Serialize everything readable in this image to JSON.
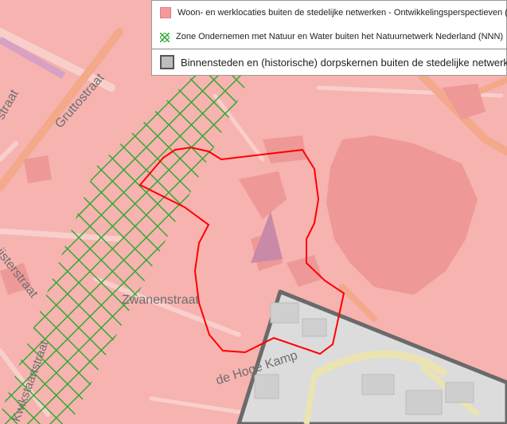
{
  "legend": {
    "items": [
      {
        "label": "Woon- en werklocaties buiten de stedelijke netwerken - Ontwikkelingsperspectieven (",
        "swatch": "#f49a9a"
      },
      {
        "label": "Zone Ondernemen met Natuur en Water buiten het Natuurnetwerk Nederland (NNN)",
        "swatch": "#2ea52e"
      },
      {
        "label": "Binnensteden en (historische) dorpskernen buiten de stedelijke netwerken",
        "swatch": "#bdbdbd"
      }
    ]
  },
  "map": {
    "streets": [
      "Gruttostraat",
      "Zwanenstraat",
      "de Hoge Kamp",
      "ijsterstraat",
      "straat",
      "Kwikstaartstraat"
    ],
    "colors": {
      "base": "#f6b3b0",
      "hatch": "#33aa33",
      "boundary": "#ff0000",
      "grey_zone": "#dcdcdc"
    }
  }
}
